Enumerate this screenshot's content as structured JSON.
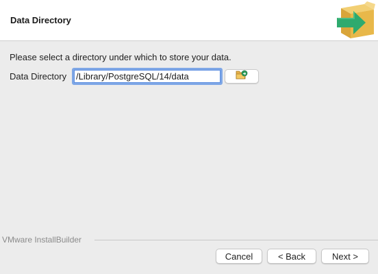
{
  "header": {
    "title": "Data Directory",
    "logo_icon": "installer-box-arrow-icon"
  },
  "main": {
    "instructions": "Please select a directory under which to store your data.",
    "data_directory": {
      "label": "Data Directory",
      "value": "/Library/PostgreSQL/14/data",
      "browse_icon": "folder-browse-icon"
    }
  },
  "footer": {
    "branding": "VMware InstallBuilder",
    "buttons": {
      "cancel": "Cancel",
      "back": "< Back",
      "next": "Next >"
    }
  },
  "colors": {
    "header_background": "#ffffff",
    "window_background": "#ececec",
    "focus_ring": "#7fa7e6",
    "logo_box": "#e8b84a",
    "logo_arrow": "#2eaa6e"
  }
}
